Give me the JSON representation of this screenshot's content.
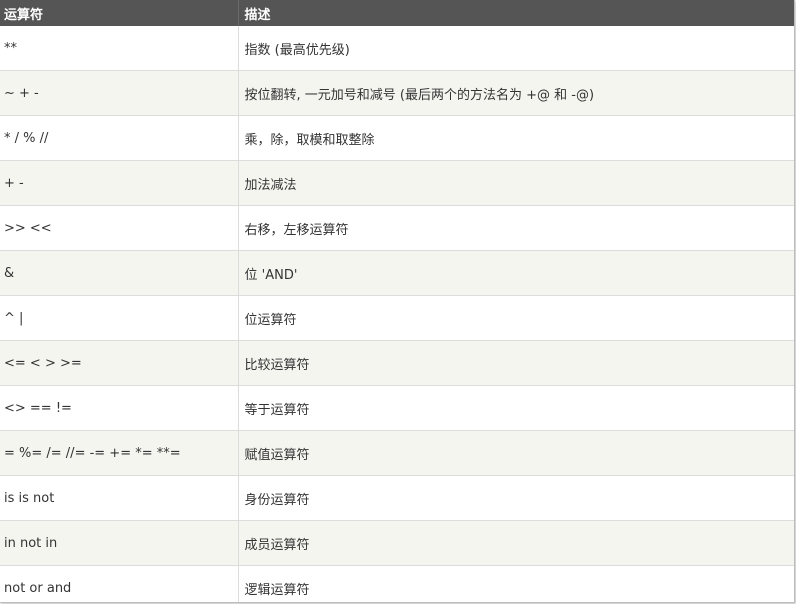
{
  "table": {
    "headers": [
      "运算符",
      "描述"
    ],
    "rows": [
      {
        "operator": "**",
        "description": "指数 (最高优先级)"
      },
      {
        "operator": "~ + -",
        "description": "按位翻转, 一元加号和减号 (最后两个的方法名为 +@ 和 -@)"
      },
      {
        "operator": "* / % //",
        "description": "乘，除，取模和取整除"
      },
      {
        "operator": "+ -",
        "description": "加法减法"
      },
      {
        "operator": ">> <<",
        "description": "右移，左移运算符"
      },
      {
        "operator": "&",
        "description": "位 'AND'"
      },
      {
        "operator": "^ |",
        "description": "位运算符"
      },
      {
        "operator": "<= < > >=",
        "description": "比较运算符"
      },
      {
        "operator": "<> == !=",
        "description": "等于运算符"
      },
      {
        "operator": "= %= /= //= -= += *= **=",
        "description": "赋值运算符"
      },
      {
        "operator": "is is not",
        "description": "身份运算符"
      },
      {
        "operator": "in not in",
        "description": "成员运算符"
      },
      {
        "operator": "not or and",
        "description": "逻辑运算符"
      }
    ]
  }
}
